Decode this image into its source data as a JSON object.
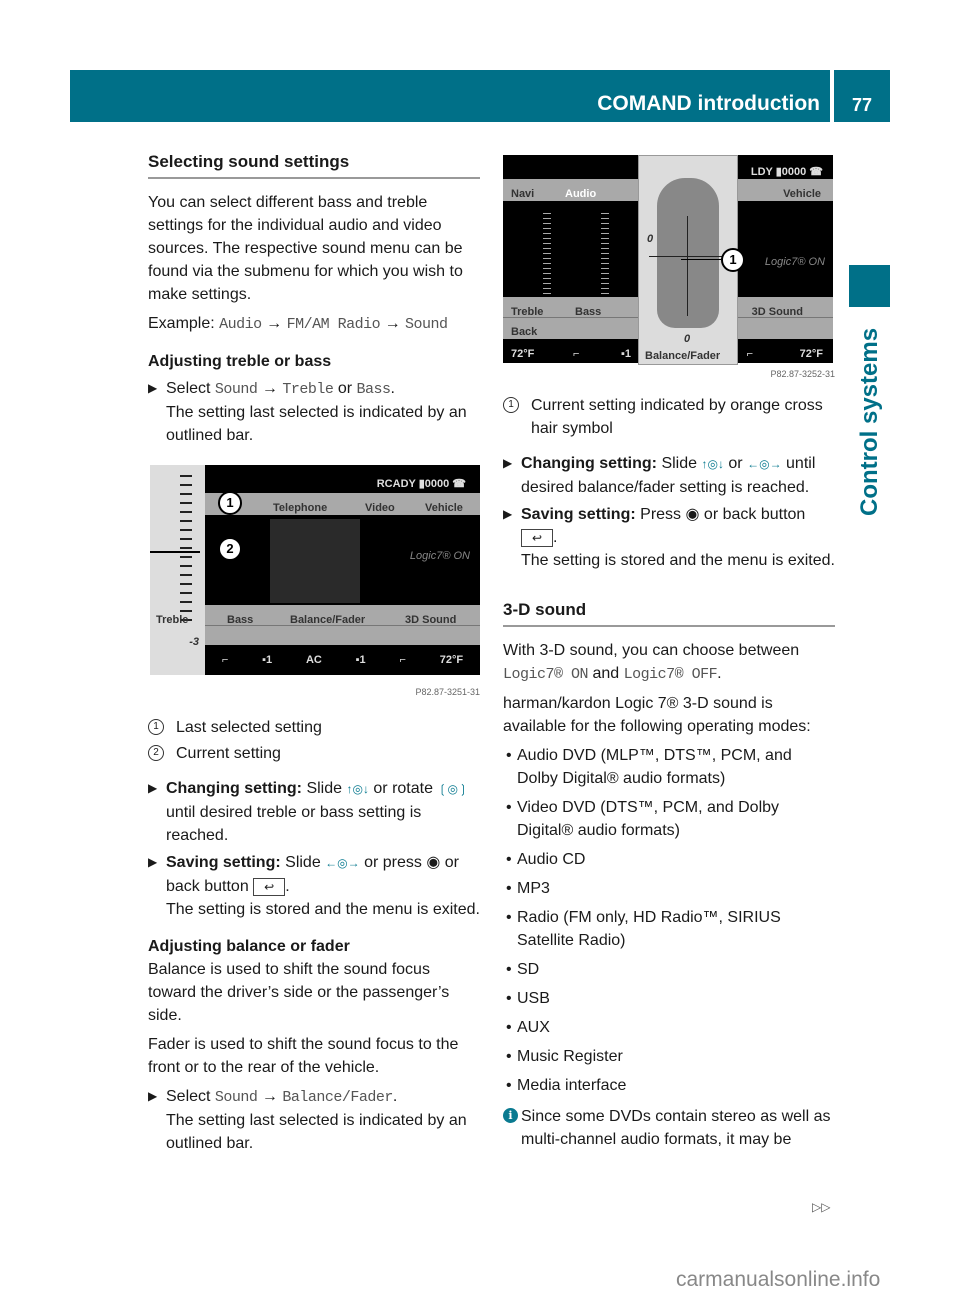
{
  "header": {
    "title": "COMAND introduction",
    "page_number": "77"
  },
  "side_tab": {
    "label": "Control systems"
  },
  "left": {
    "heading": "Selecting sound settings",
    "intro": "You can select different bass and treble settings for the individual audio and video sources. The respective sound menu can be found via the submenu for which you wish to make settings.",
    "example_label": "Example:",
    "example_path": [
      "Audio",
      "FM/AM Radio",
      "Sound"
    ],
    "sub1": "Adjusting treble or bass",
    "step1_prefix": "Select",
    "step1_path1": "Sound",
    "step1_path2": "Treble",
    "step1_or": "or",
    "step1_path3": "Bass",
    "step1_note": "The setting last selected is indicated by an outlined bar.",
    "figure1": {
      "status": "RCADY ▮0000 ☎",
      "tabs": [
        "Telephone",
        "Video",
        "Vehicle"
      ],
      "logic": "Logic7® ON",
      "side_label": "Treble",
      "side_value": "-3",
      "menu": [
        "Bass",
        "Balance/Fader",
        "3D Sound"
      ],
      "climate": [
        "⌐",
        "▪1",
        "AC",
        "▪1",
        "⌐",
        "72°F"
      ],
      "code": "P82.87-3251-31",
      "callouts": [
        "1",
        "2"
      ]
    },
    "legend": [
      {
        "num": "1",
        "text": "Last selected setting"
      },
      {
        "num": "2",
        "text": "Current setting"
      }
    ],
    "change_label": "Changing setting:",
    "change_text_a": "Slide",
    "change_text_b": "or rotate",
    "change_text_c": "until desired treble or bass setting is reached.",
    "save_label": "Saving setting:",
    "save_text_a": "Slide",
    "save_text_b": "or press",
    "save_text_c": "or back button",
    "save_note": "The setting is stored and the menu is exited.",
    "sub2": "Adjusting balance or fader",
    "balance_text": "Balance is used to shift the sound focus toward the driver’s side or the passenger’s side.",
    "fader_text": "Fader is used to shift the sound focus to the front or to the rear of the vehicle.",
    "step2_prefix": "Select",
    "step2_path1": "Sound",
    "step2_path2": "Balance/Fader",
    "step2_note": "The setting last selected is indicated by an outlined bar."
  },
  "right": {
    "figure2": {
      "status": "LDY ▮0000 ☎",
      "tabs_left": [
        "Navi",
        "Audio"
      ],
      "tab_right": "Vehicle",
      "logic": "Logic7® ON",
      "menu_left": [
        "Treble",
        "Bass"
      ],
      "menu_right": "3D Sound",
      "back": "Back",
      "zero_left": "0",
      "zero_bottom": "0",
      "popup_label": "Balance/Fader",
      "climate_left": [
        "72°F",
        "⌐",
        "▪1"
      ],
      "climate_right": [
        "⌐",
        "72°F"
      ],
      "code": "P82.87-3252-31",
      "callout": "1"
    },
    "legend": [
      {
        "num": "1",
        "text": "Current setting indicated by orange cross hair symbol"
      }
    ],
    "change_label": "Changing setting:",
    "change_text_a": "Slide",
    "change_text_b": "or",
    "change_text_c": "until desired balance/fader setting is reached.",
    "save_label": "Saving setting:",
    "save_text_a": "Press",
    "save_text_b": "or back button",
    "save_note": "The setting is stored and the menu is exited.",
    "heading": "3-D sound",
    "choose_text": "With 3-D sound, you can choose between",
    "opt_on": "Logic7® ON",
    "and": "and",
    "opt_off": "Logic7® OFF",
    "hk_text": "harman/kardon Logic 7® 3-D sound is available for the following operating modes:",
    "modes": [
      "Audio DVD (MLP™, DTS™, PCM, and Dolby Digital® audio formats)",
      "Video DVD (DTS™, PCM, and Dolby Digital® audio formats)",
      "Audio CD",
      "MP3",
      "Radio (FM only, HD Radio™, SIRIUS Satellite Radio)",
      "SD",
      "USB",
      "AUX",
      "Music Register",
      "Media interface"
    ],
    "info_text": "Since some DVDs contain stereo as well as multi-channel audio formats, it may be"
  },
  "footer": {
    "continue_icon": "▷▷",
    "watermark": "carmanualsonline.info"
  },
  "colors": {
    "brand": "#007088",
    "controller": "#0a7a90"
  }
}
